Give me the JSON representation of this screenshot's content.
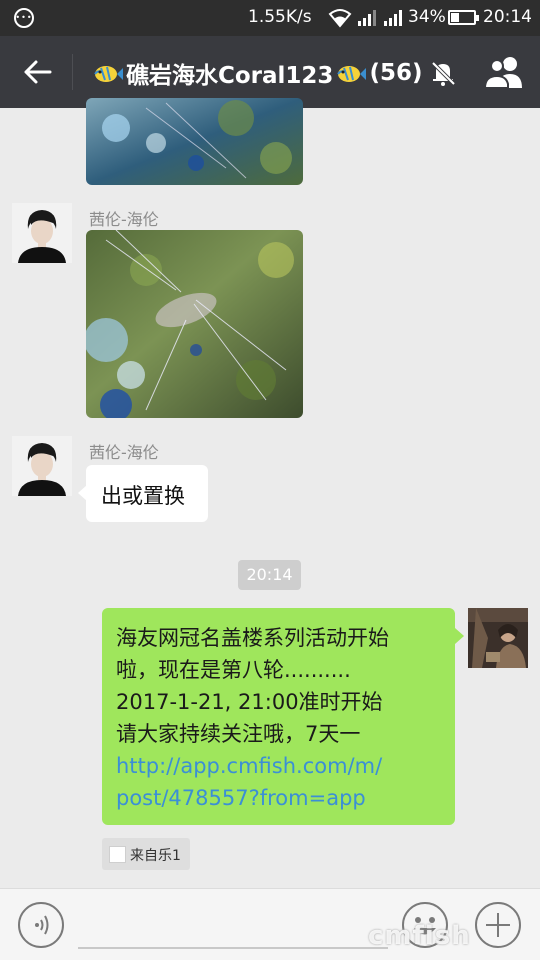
{
  "status_bar": {
    "speed": "1.55K/s",
    "battery_pct": "34%",
    "time": "20:14"
  },
  "header": {
    "title": "礁岩海水Coral123",
    "member_count": "(56)",
    "icons": [
      "back-arrow-icon",
      "fish-icon",
      "mute-bell-icon",
      "group-members-icon"
    ]
  },
  "messages": [
    {
      "type": "image",
      "from": "other",
      "sender": ""
    },
    {
      "type": "image",
      "from": "other",
      "sender": "茜伦-海伦"
    },
    {
      "type": "text",
      "from": "other",
      "sender": "茜伦-海伦",
      "text": "出或置换"
    },
    {
      "type": "timestamp",
      "text": "20:14"
    },
    {
      "type": "text",
      "from": "me",
      "lines": [
        "海友网冠名盖楼系列活动开始",
        "啦，现在是第八轮..........",
        "2017-1-21, 21:00准时开始",
        "请大家持续关注哦，7天一"
      ],
      "link_lines": [
        "http://app.cmfish.com/m/",
        "post/478557?from=app"
      ],
      "source": "来自乐1"
    }
  ],
  "input_bar": {
    "icons": [
      "voice-icon",
      "emoji-icon",
      "plus-icon"
    ]
  },
  "watermark": "cmfish"
}
